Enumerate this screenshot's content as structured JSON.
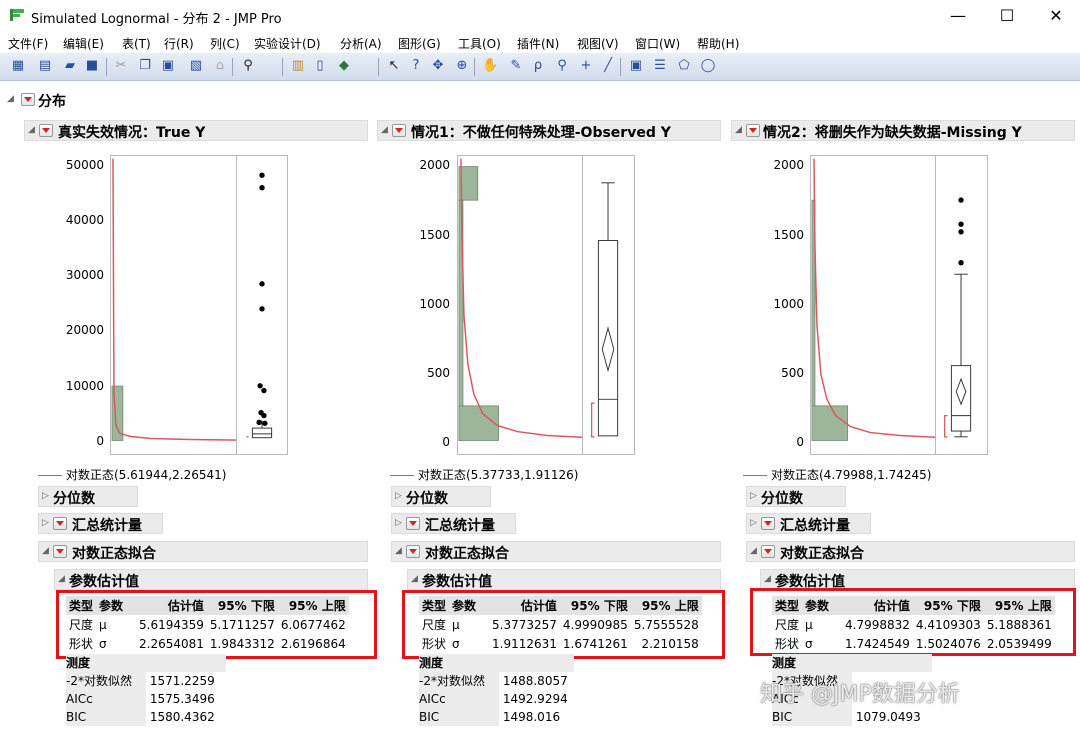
{
  "window": {
    "title": "Simulated Lognormal - 分布 2 - JMP Pro",
    "minimize": "—",
    "maximize": "☐",
    "close": "✕"
  },
  "menu": [
    "文件(F)",
    "编辑(E)",
    "表(T)",
    "行(R)",
    "列(C)",
    "实验设计(D)",
    "分析(A)",
    "图形(G)",
    "工具(O)",
    "插件(N)",
    "视图(V)",
    "窗口(W)",
    "帮助(H)"
  ],
  "report": {
    "title": "分布",
    "columns": [
      {
        "title": "真实失效情况：True Y",
        "y_ticks": [
          "50000",
          "40000",
          "30000",
          "20000",
          "10000",
          "0"
        ],
        "legend": "对数正态(5.61944,2.26541)",
        "params": [
          {
            "type": "尺度",
            "param": "μ",
            "est": "5.6194359",
            "lower": "5.1711257",
            "upper": "6.0677462"
          },
          {
            "type": "形状",
            "param": "σ",
            "est": "2.2654081",
            "lower": "1.9843312",
            "upper": "2.6196864"
          }
        ],
        "fit": [
          {
            "label": "测度",
            "value": ""
          },
          {
            "label": "-2*对数似然",
            "value": "1571.2259"
          },
          {
            "label": "AICc",
            "value": "1575.3496"
          },
          {
            "label": "BIC",
            "value": "1580.4362"
          }
        ]
      },
      {
        "title": "情况1：不做任何特殊处理-Observed Y",
        "y_ticks": [
          "2000",
          "1500",
          "1000",
          "500",
          "0"
        ],
        "legend": "对数正态(5.37733,1.91126)",
        "params": [
          {
            "type": "尺度",
            "param": "μ",
            "est": "5.3773257",
            "lower": "4.9990985",
            "upper": "5.7555528"
          },
          {
            "type": "形状",
            "param": "σ",
            "est": "1.9112631",
            "lower": "1.6741261",
            "upper": "2.210158"
          }
        ],
        "fit": [
          {
            "label": "测度",
            "value": ""
          },
          {
            "label": "-2*对数似然",
            "value": "1488.8057"
          },
          {
            "label": "AICc",
            "value": "1492.9294"
          },
          {
            "label": "BIC",
            "value": "1498.016"
          }
        ]
      },
      {
        "title": "情况2：将删失作为缺失数据-Missing Y",
        "y_ticks": [
          "2000",
          "1500",
          "1000",
          "500",
          "0"
        ],
        "legend": "对数正态(4.79988,1.74245)",
        "params": [
          {
            "type": "尺度",
            "param": "μ",
            "est": "4.7998832",
            "lower": "4.4109303",
            "upper": "5.1888361"
          },
          {
            "type": "形状",
            "param": "σ",
            "est": "1.7424549",
            "lower": "1.5024076",
            "upper": "2.0539499"
          }
        ],
        "fit": [
          {
            "label": "测度",
            "value": ""
          },
          {
            "label": "-2*对数似然",
            "value": ""
          },
          {
            "label": "AICc",
            "value": ""
          },
          {
            "label": "BIC",
            "value": "1079.0493"
          }
        ]
      }
    ],
    "sections": {
      "quantiles": "分位数",
      "summary": "汇总统计量",
      "lognormal_fit": "对数正态拟合",
      "param_estimates": "参数估计值"
    },
    "table_headers": {
      "type": "类型",
      "param": "参数",
      "est": "估计值",
      "lower": "95% 下限",
      "upper": "95% 上限"
    }
  },
  "watermark": "知乎 @JMP数据分析",
  "colors": {
    "curve": "#d9595e",
    "bar": "#9db59b",
    "highlight": "#e0141a"
  }
}
